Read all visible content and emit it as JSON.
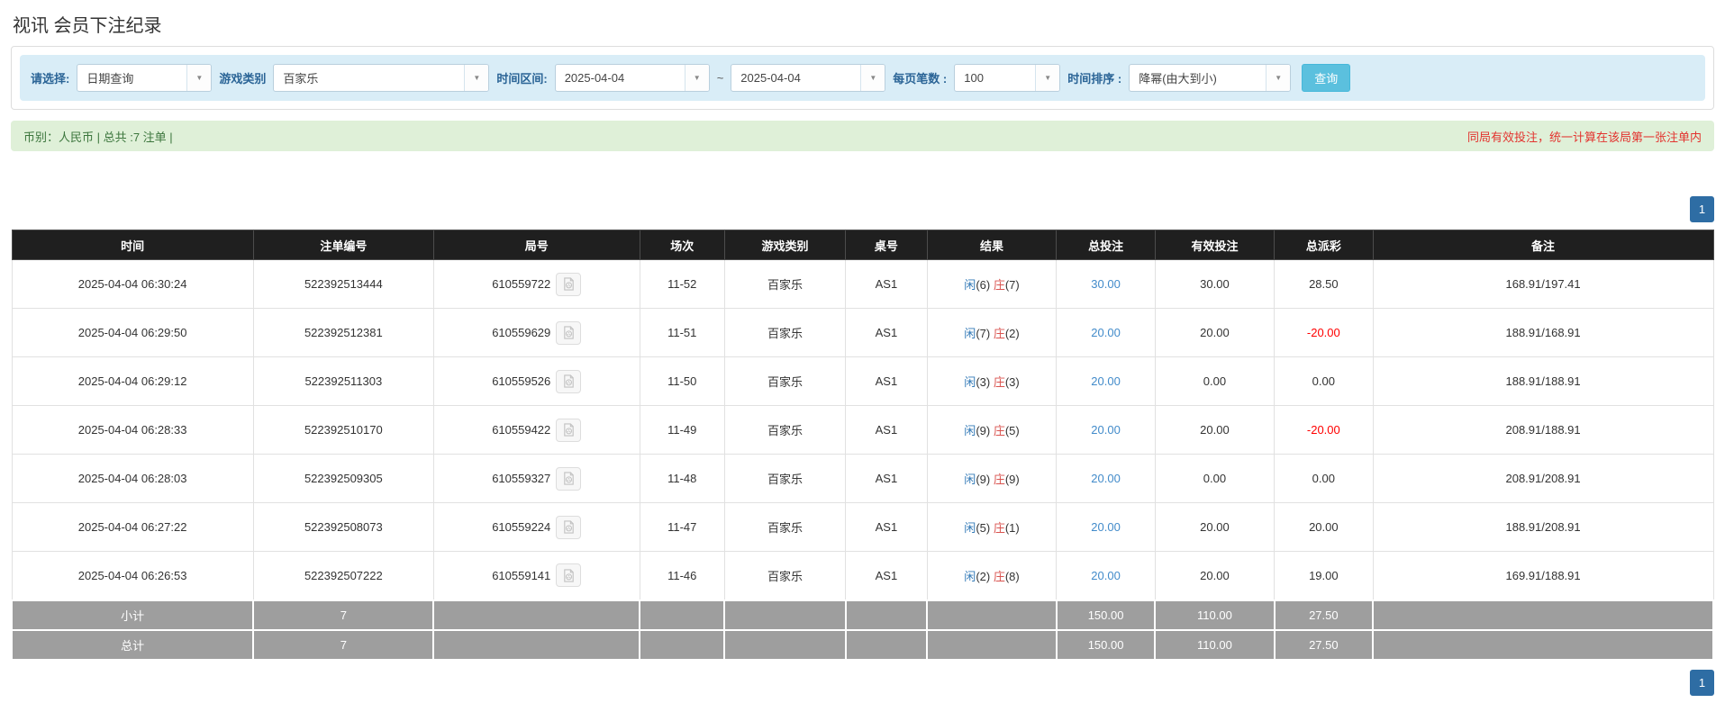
{
  "page": {
    "title": "视讯 会员下注纪录"
  },
  "filters": {
    "select_label": "请选择:",
    "select_value": "日期查询",
    "game_label": "游戏类别",
    "game_value": "百家乐",
    "range_label": "时间区间:",
    "date_from": "2025-04-04",
    "tilde": "~",
    "date_to": "2025-04-04",
    "per_page_label": "每页笔数 :",
    "per_page_value": "100",
    "sort_label": "时间排序 :",
    "sort_value": "降幂(由大到小)",
    "search_button": "查询"
  },
  "summary": {
    "left": "币别：人民币 | 总共 :7 注单 |",
    "right": "同局有效投注，统一计算在该局第一张注单内"
  },
  "pagination": {
    "page": "1"
  },
  "colors": {
    "accent_blue": "#2e6da4",
    "info_button": "#5bc0de",
    "filter_bg": "#d9edf7",
    "success_bg": "#dff0d8",
    "negative_red": "#ff0000",
    "link_blue": "#428bca"
  },
  "icons": {
    "dropdown_arrow": "▼",
    "video_button": "video-file-icon"
  },
  "table": {
    "headers": [
      "时间",
      "注单编号",
      "局号",
      "场次",
      "游戏类别",
      "桌号",
      "结果",
      "总投注",
      "有效投注",
      "总派彩",
      "备注"
    ],
    "rows": [
      {
        "time": "2025-04-04 06:30:24",
        "bet_id": "522392513444",
        "round_id": "610559722",
        "session": "11-52",
        "game": "百家乐",
        "table_no": "AS1",
        "xian": "闲",
        "xian_n": "(6)",
        "zhuang": "庄",
        "zhuang_n": "(7)",
        "total_bet": "30.00",
        "valid_bet": "30.00",
        "payout": "28.50",
        "payout_class": "",
        "remark": "168.91/197.41"
      },
      {
        "time": "2025-04-04 06:29:50",
        "bet_id": "522392512381",
        "round_id": "610559629",
        "session": "11-51",
        "game": "百家乐",
        "table_no": "AS1",
        "xian": "闲",
        "xian_n": "(7)",
        "zhuang": "庄",
        "zhuang_n": "(2)",
        "total_bet": "20.00",
        "valid_bet": "20.00",
        "payout": "-20.00",
        "payout_class": "payout-neg",
        "remark": "188.91/168.91"
      },
      {
        "time": "2025-04-04 06:29:12",
        "bet_id": "522392511303",
        "round_id": "610559526",
        "session": "11-50",
        "game": "百家乐",
        "table_no": "AS1",
        "xian": "闲",
        "xian_n": "(3)",
        "zhuang": "庄",
        "zhuang_n": "(3)",
        "total_bet": "20.00",
        "valid_bet": "0.00",
        "payout": "0.00",
        "payout_class": "",
        "remark": "188.91/188.91"
      },
      {
        "time": "2025-04-04 06:28:33",
        "bet_id": "522392510170",
        "round_id": "610559422",
        "session": "11-49",
        "game": "百家乐",
        "table_no": "AS1",
        "xian": "闲",
        "xian_n": "(9)",
        "zhuang": "庄",
        "zhuang_n": "(5)",
        "total_bet": "20.00",
        "valid_bet": "20.00",
        "payout": "-20.00",
        "payout_class": "payout-neg",
        "remark": "208.91/188.91"
      },
      {
        "time": "2025-04-04 06:28:03",
        "bet_id": "522392509305",
        "round_id": "610559327",
        "session": "11-48",
        "game": "百家乐",
        "table_no": "AS1",
        "xian": "闲",
        "xian_n": "(9)",
        "zhuang": "庄",
        "zhuang_n": "(9)",
        "total_bet": "20.00",
        "valid_bet": "0.00",
        "payout": "0.00",
        "payout_class": "",
        "remark": "208.91/208.91"
      },
      {
        "time": "2025-04-04 06:27:22",
        "bet_id": "522392508073",
        "round_id": "610559224",
        "session": "11-47",
        "game": "百家乐",
        "table_no": "AS1",
        "xian": "闲",
        "xian_n": "(5)",
        "zhuang": "庄",
        "zhuang_n": "(1)",
        "total_bet": "20.00",
        "valid_bet": "20.00",
        "payout": "20.00",
        "payout_class": "",
        "remark": "188.91/208.91"
      },
      {
        "time": "2025-04-04 06:26:53",
        "bet_id": "522392507222",
        "round_id": "610559141",
        "session": "11-46",
        "game": "百家乐",
        "table_no": "AS1",
        "xian": "闲",
        "xian_n": "(2)",
        "zhuang": "庄",
        "zhuang_n": "(8)",
        "total_bet": "20.00",
        "valid_bet": "20.00",
        "payout": "19.00",
        "payout_class": "",
        "remark": "169.91/188.91"
      }
    ],
    "subtotal": {
      "label": "小计",
      "count": "7",
      "total_bet": "150.00",
      "valid_bet": "110.00",
      "payout": "27.50"
    },
    "total": {
      "label": "总计",
      "count": "7",
      "total_bet": "150.00",
      "valid_bet": "110.00",
      "payout": "27.50"
    }
  }
}
